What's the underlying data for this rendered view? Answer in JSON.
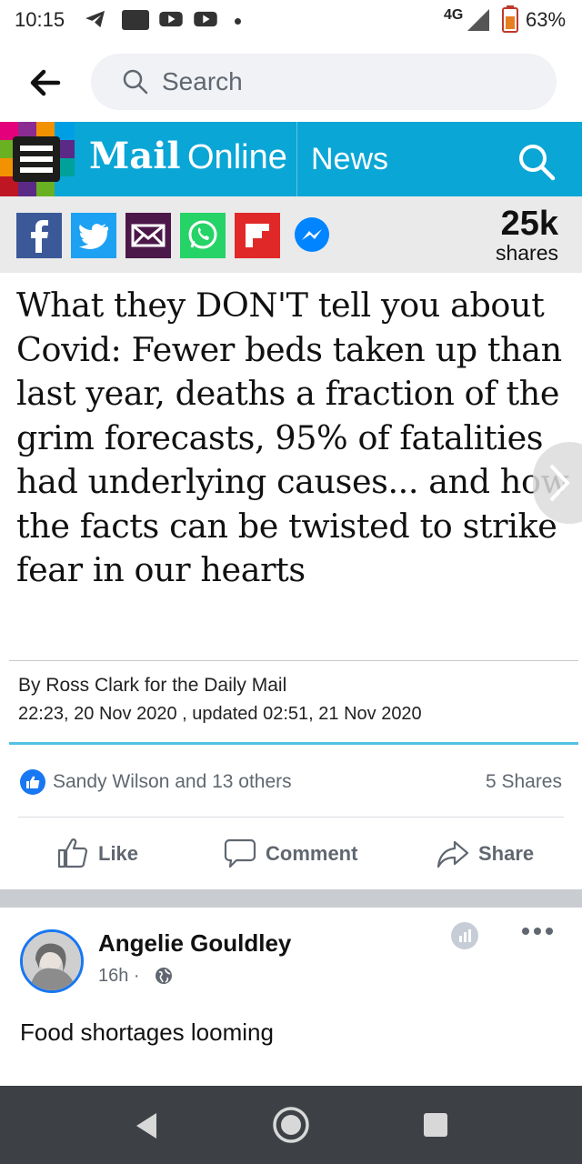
{
  "status_bar": {
    "time": "10:15",
    "network": "4G",
    "battery": "63%"
  },
  "search": {
    "placeholder": "Search"
  },
  "site": {
    "brand_mail": "Mail",
    "brand_online": "Online",
    "section": "News"
  },
  "share": {
    "count": "25k",
    "label": "shares"
  },
  "article": {
    "headline": "What they DON'T tell you about Covid: Fewer beds taken up than last year, deaths a fraction of the grim forecasts, 95% of fatalities had underlying causes... and how the facts can be twisted to strike fear in our hearts",
    "byline": "By Ross Clark for the Daily Mail",
    "date": "22:23, 20 Nov 2020 , updated 02:51, 21 Nov 2020"
  },
  "reactions": {
    "reactors": "Sandy Wilson and 13 others",
    "shares": "5 Shares"
  },
  "actions": {
    "like": "Like",
    "comment": "Comment",
    "share": "Share"
  },
  "post": {
    "author": "Angelie Gouldley",
    "time": "16h ·",
    "text": "Food shortages looming"
  },
  "colors": {
    "mail_blue": "#0aa6d6",
    "facebook_blue": "#1877f2",
    "nav_bg": "#3d4145"
  }
}
